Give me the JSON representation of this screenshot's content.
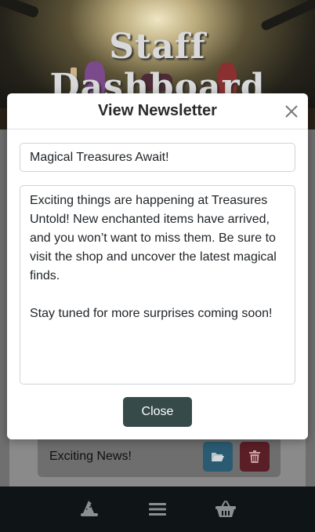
{
  "header": {
    "title": "Staff Dashboard"
  },
  "newsletter_list": {
    "items": [
      {
        "title": "Exciting News!"
      }
    ]
  },
  "modal": {
    "title": "View Newsletter",
    "subject_value": "Magical Treasures Await!",
    "body_value": "Exciting things are happening at Treasures Untold! New enchanted items have arrived, and you won’t want to miss them. Be sure to visit the shop and uncover the latest magical finds.\n\nStay tuned for more surprises coming soon!",
    "close_label": "Close"
  },
  "bottom_nav": {
    "icons": [
      "wizard-hat-icon",
      "menu-icon",
      "basket-icon"
    ]
  },
  "colors": {
    "close_button": "#364a4a",
    "open_button": "#2a5b72",
    "delete_button": "#5a1e26",
    "nav_background": "#0f1517"
  }
}
